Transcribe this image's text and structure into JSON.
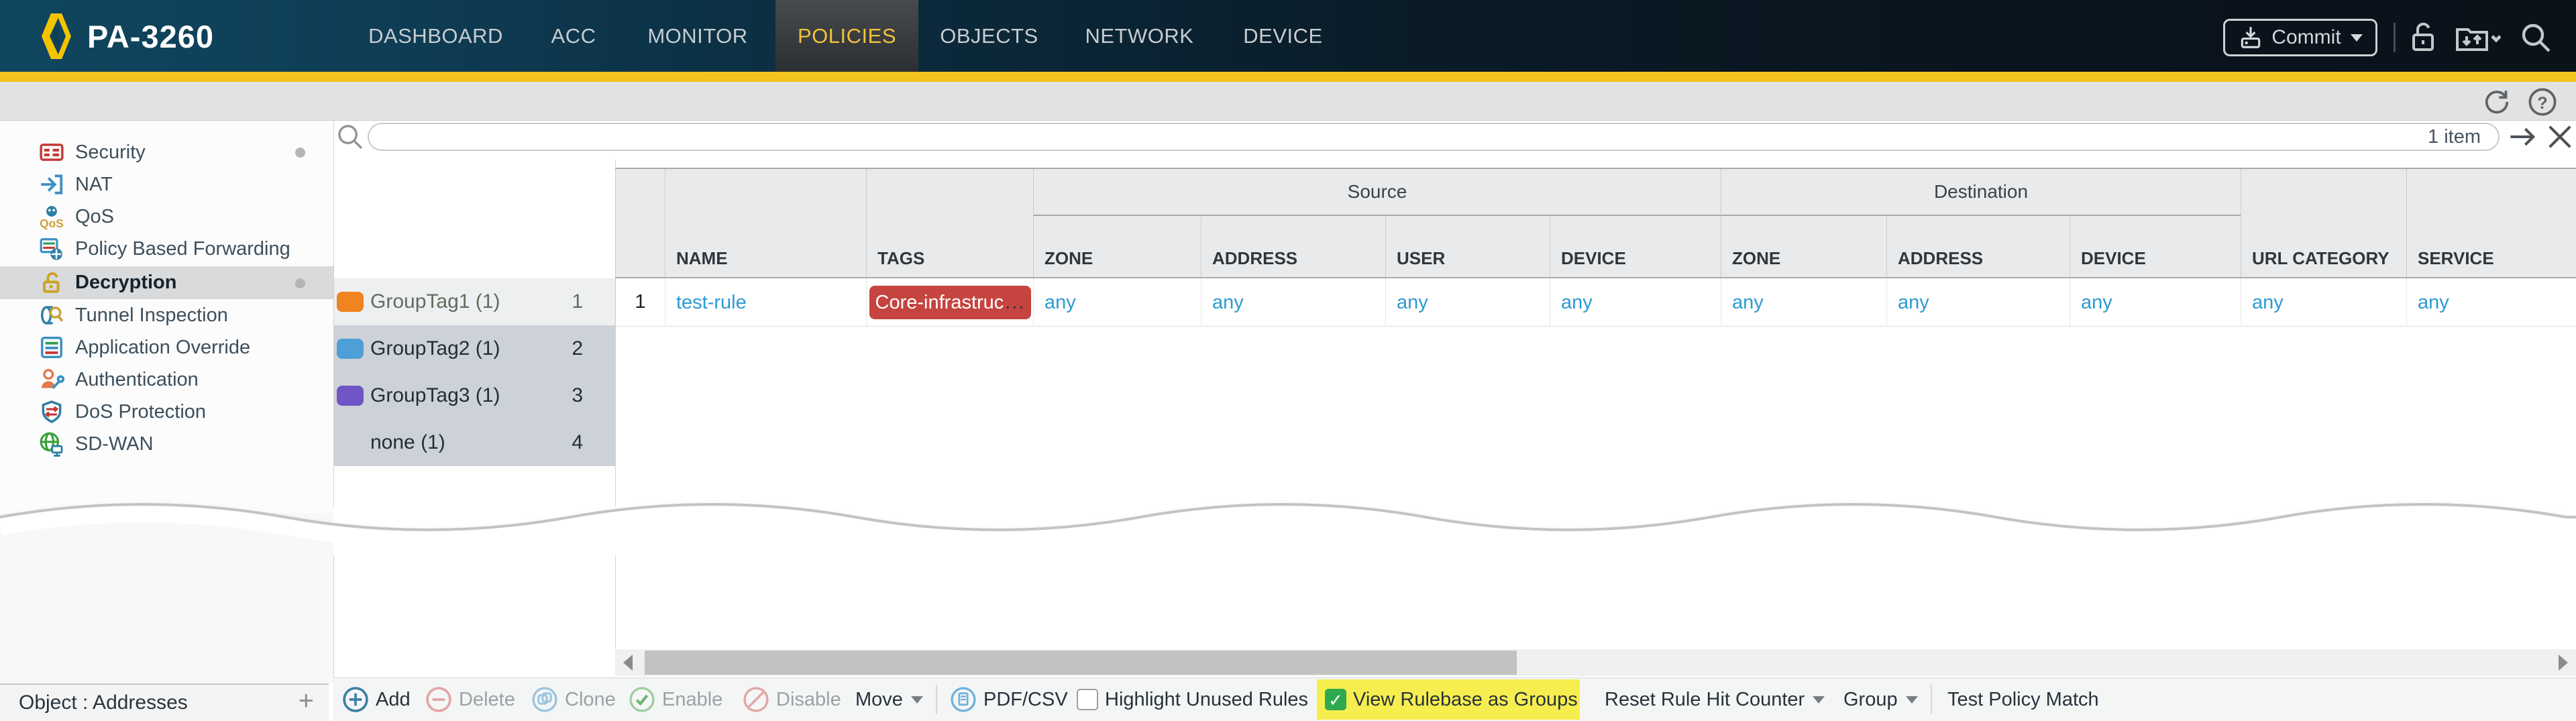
{
  "nav": {
    "device_name": "PA-3260",
    "tabs": [
      {
        "label": "DASHBOARD",
        "active": false
      },
      {
        "label": "ACC",
        "active": false
      },
      {
        "label": "MONITOR",
        "active": false
      },
      {
        "label": "POLICIES",
        "active": true
      },
      {
        "label": "OBJECTS",
        "active": false
      },
      {
        "label": "NETWORK",
        "active": false
      },
      {
        "label": "DEVICE",
        "active": false
      }
    ],
    "commit_label": "Commit",
    "icons": [
      "commit-icon",
      "lock-open-icon",
      "config-versions-icon",
      "search-icon"
    ]
  },
  "toolbar_strip": {
    "icons": [
      "refresh-icon",
      "help-icon"
    ]
  },
  "search": {
    "value": "",
    "count_label": "1 item",
    "icons": [
      "search-icon",
      "apply-filter-arrow-icon",
      "clear-filter-x-icon"
    ]
  },
  "sidebar": {
    "items": [
      {
        "label": "Security",
        "icon": "security-icon",
        "dot": true,
        "selected": false
      },
      {
        "label": "NAT",
        "icon": "nat-icon",
        "dot": false,
        "selected": false
      },
      {
        "label": "QoS",
        "icon": "qos-icon",
        "dot": false,
        "selected": false
      },
      {
        "label": "Policy Based Forwarding",
        "icon": "pbf-icon",
        "dot": false,
        "selected": false
      },
      {
        "label": "Decryption",
        "icon": "decryption-icon",
        "dot": true,
        "selected": true
      },
      {
        "label": "Tunnel Inspection",
        "icon": "tunnel-icon",
        "dot": false,
        "selected": false
      },
      {
        "label": "Application Override",
        "icon": "app-override-icon",
        "dot": false,
        "selected": false
      },
      {
        "label": "Authentication",
        "icon": "auth-icon",
        "dot": false,
        "selected": false
      },
      {
        "label": "DoS Protection",
        "icon": "dos-icon",
        "dot": false,
        "selected": false
      },
      {
        "label": "SD-WAN",
        "icon": "sdwan-icon",
        "dot": false,
        "selected": false
      }
    ]
  },
  "group_list": {
    "rows": [
      {
        "label": "GroupTag1 (1)",
        "order": "1",
        "swatch": "#ef8420",
        "swatch_style": "background:#ef8420"
      },
      {
        "label": "GroupTag2 (1)",
        "order": "2",
        "swatch": "#4d9fd6",
        "swatch_style": "background:#4d9fd6"
      },
      {
        "label": "GroupTag3 (1)",
        "order": "3",
        "swatch": "#6f55c5",
        "swatch_style": "background:#6f55c5"
      },
      {
        "label": "none (1)",
        "order": "4",
        "swatch": null
      }
    ]
  },
  "table": {
    "group_headers": {
      "source": "Source",
      "destination": "Destination"
    },
    "columns": [
      "NAME",
      "TAGS",
      "ZONE",
      "ADDRESS",
      "USER",
      "DEVICE",
      "ZONE",
      "ADDRESS",
      "DEVICE",
      "URL CATEGORY",
      "SERVICE"
    ],
    "row": {
      "number": "1",
      "name": "test-rule",
      "tag_label": "Core-infrastruc",
      "tag_ellipsis": "...",
      "tag_style": "background:#c5443f",
      "cells": [
        "any",
        "any",
        "any",
        "any",
        "any",
        "any",
        "any",
        "any",
        "any"
      ]
    }
  },
  "footer": {
    "panel_label": "Object : Addresses",
    "panel_add": "+",
    "add": "Add",
    "delete": "Delete",
    "clone": "Clone",
    "enable": "Enable",
    "disable": "Disable",
    "move": "Move",
    "pdf_csv": "PDF/CSV",
    "highlight_unused": "Highlight Unused Rules",
    "view_rulebase": "View Rulebase as Groups",
    "view_rulebase_check": "✓",
    "reset_hit": "Reset Rule Hit Counter",
    "group": "Group",
    "test_policy": "Test Policy Match"
  },
  "colors": {
    "accent_yellow": "#f2c41d",
    "highlight_yellow": "#f6ee4e",
    "tag_red": "#c5443f",
    "link_blue": "#2d9ad3",
    "check_green": "#2fa94f",
    "swatch_orange": "#ef8420",
    "swatch_blue": "#4d9fd6",
    "swatch_purple": "#6f55c5"
  }
}
